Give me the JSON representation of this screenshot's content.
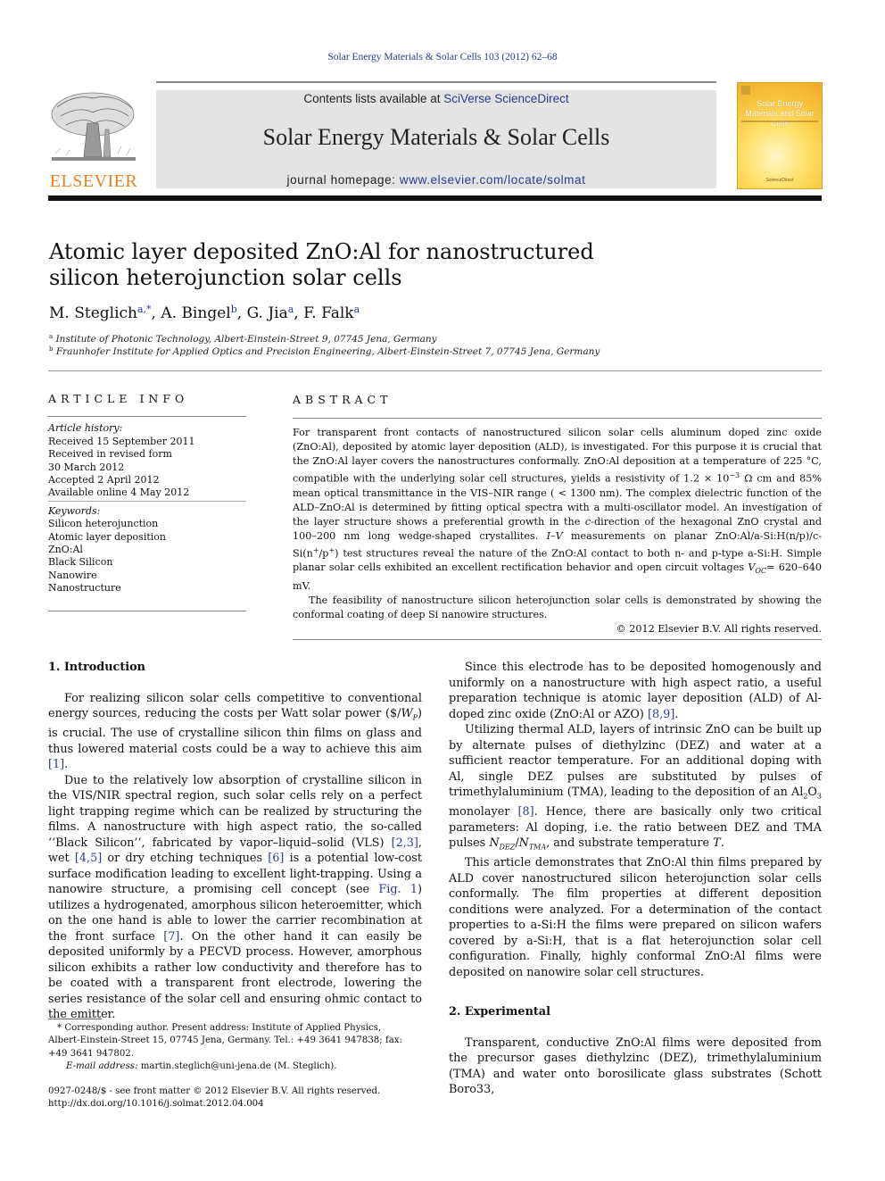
{
  "journal": {
    "running_head": "Solar Energy Materials & Solar Cells 103 (2012) 62–68",
    "contents_prefix": "Contents lists available at ",
    "contents_link": "SciVerse ScienceDirect",
    "title": "Solar Energy Materials & Solar Cells",
    "homepage_prefix": "journal homepage: ",
    "homepage_link": "www.elsevier.com/locate/solmat",
    "publisher_logo_text": "ELSEVIER",
    "cover_title": "Solar Energy Materials and Solar Cells",
    "cover_footer": "ScienceDirect",
    "colors": {
      "link": "#2a3b8f",
      "publisher_orange": "#e8801f",
      "banner_bg": "#e4e4e4"
    }
  },
  "article": {
    "title_line1": "Atomic layer deposited ZnO:Al for nanostructured",
    "title_line2": "silicon heterojunction solar cells",
    "authors": [
      {
        "name": "M. Steglich",
        "sup": "a,",
        "star": "*",
        "sep": ", "
      },
      {
        "name": "A. Bingel",
        "sup": "b",
        "sep": ", "
      },
      {
        "name": "G. Jia",
        "sup": "a",
        "sep": ", "
      },
      {
        "name": "F. Falk",
        "sup": "a",
        "sep": ""
      }
    ],
    "affiliations": [
      {
        "mark": "a",
        "text": "Institute of Photonic Technology, Albert-Einstein-Street 9, 07745 Jena, Germany"
      },
      {
        "mark": "b",
        "text": "Fraunhofer Institute for Applied Optics and Precision Engineering, Albert-Einstein-Street 7, 07745 Jena, Germany"
      }
    ]
  },
  "article_info": {
    "heading": "ARTICLE INFO",
    "history_label": "Article history:",
    "history": [
      "Received 15 September 2011",
      "Received in revised form",
      "30 March 2012",
      "Accepted 2 April 2012",
      "Available online 4 May 2012"
    ],
    "keywords_label": "Keywords:",
    "keywords": [
      "Silicon heterojunction",
      "Atomic layer deposition",
      "ZnO:Al",
      "Black Silicon",
      "Nanowire",
      "Nanostructure"
    ]
  },
  "abstract": {
    "heading": "ABSTRACT",
    "p1_a": "For transparent front contacts of nanostructured silicon solar cells aluminum doped zinc oxide (ZnO:Al), deposited by atomic layer deposition (ALD), is investigated. For this purpose it is crucial that the ZnO:Al layer covers the nanostructures conformally. ZnO:Al deposition at a temperature of 225 °C, compatible with the underlying solar cell structures, yields a resistivity of 1.2 × 10",
    "p1_exp": "−3",
    "p1_b": " Ω cm and 85% mean optical transmittance in the VIS–NIR range ( < 1300 nm). The complex dielectric function of the ALD–ZnO:Al is determined by fitting optical spectra with a multi-oscillator model. An investigation of the layer structure shows a preferential growth in the ",
    "p1_c_italic": "c",
    "p1_c": "-direction of the hexagonal ZnO crystal and 100–200 nm long wedge-shaped crystallites. ",
    "p1_iv": "I–V",
    "p1_d": " measurements on planar ZnO:Al/a-Si:H(n/p)/c-Si(n",
    "p1_sup1": "+",
    "p1_e": "/p",
    "p1_sup2": "+",
    "p1_f": ") test structures reveal the nature of the ZnO:Al contact to both n- and p-type a-Si:H. Simple planar solar cells exhibited an excellent rectification behavior and open circuit voltages ",
    "p1_voc": "V",
    "p1_voc_sub": "OC",
    "p1_g": "= 620–640 mV.",
    "p2": "The feasibility of nanostructure silicon heterojunction solar cells is demonstrated by showing the conformal coating of deep Si nanowire structures.",
    "copyright": "© 2012 Elsevier B.V. All rights reserved."
  },
  "body": {
    "intro_heading": "1.  Introduction",
    "intro_p1_a": "For realizing silicon solar cells competitive to conventional energy sources, reducing the costs per Watt solar power ($/",
    "intro_p1_wp": "W",
    "intro_p1_wp_sub": "P",
    "intro_p1_b": ") is crucial. The use of crystalline silicon thin films on glass and thus lowered material costs could be a way to achieve this aim ",
    "ref1": "[1]",
    "intro_p2_a": "Due to the relatively low absorption of crystalline silicon in the VIS/NIR spectral region, such solar cells rely on a perfect light trapping regime which can be realized by structuring the films. A nanostructure with high aspect ratio, the so-called ‘‘Black Silicon’’, fabricated by vapor–liquid–solid (VLS) ",
    "ref23": "[2,3]",
    "intro_p2_b": ", wet ",
    "ref45": "[4,5]",
    "intro_p2_c": " or dry etching techniques ",
    "ref6": "[6]",
    "intro_p2_d": " is a potential low-cost surface modification leading to excellent light-trapping. Using a nanowire structure, a promising cell concept (see ",
    "fig1": "Fig. 1",
    "intro_p2_e": ") utilizes a hydrogenated, amorphous silicon heteroemitter, which on the one hand is able to lower the carrier recombination at the front surface ",
    "ref7": "[7]",
    "intro_p2_f": ". On the other hand it can easily be deposited uniformly by a PECVD process. However, amorphous silicon exhibits a rather low conductivity and therefore has to be coated with a transparent front electrode, lowering the series resistance of the solar cell and ensuring ohmic contact to the emitter.",
    "right_p1_a": "Since this electrode has to be deposited homogenously and uniformly on a nanostructure with high aspect ratio, a useful preparation technique is atomic layer deposition (ALD) of Al-doped zinc oxide (ZnO:Al or AZO) ",
    "ref89": "[8,9]",
    "right_p2_a": "Utilizing thermal ALD, layers of intrinsic ZnO can be built up by alternate pulses of diethylzinc (DEZ) and water at a sufficient reactor temperature. For an additional doping with Al, single DEZ pulses are substituted by pulses of trimethylaluminium (TMA), leading to the deposition of an Al",
    "right_p2_sub2": "2",
    "right_p2_o": "O",
    "right_p2_sub3": "3",
    "right_p2_b": " monolayer ",
    "ref8": "[8]",
    "right_p2_c": ". Hence, there are basically only two critical parameters: Al doping, i.e. the ratio between DEZ and TMA pulses ",
    "ndez": "N",
    "ndez_sub": "DEZ",
    "ntma": "N",
    "ntma_sub": "TMA",
    "right_p2_d": ", and substrate temperature ",
    "temp_T": "T",
    "right_p3": "This article demonstrates that ZnO:Al thin films prepared by ALD cover nanostructured silicon heterojunction solar cells conformally. The film properties at different deposition conditions were analyzed. For a determination of the contact properties to a-Si:H the films were prepared on silicon wafers covered by a-Si:H, that is a flat heterojunction solar cell configuration. Finally, highly conformal ZnO:Al films were deposited on nanowire solar cell structures.",
    "exp_heading": "2.  Experimental",
    "exp_p1": "Transparent, conductive ZnO:Al films were deposited from the precursor gases diethylzinc (DEZ), trimethylaluminium (TMA) and water onto borosilicate glass substrates (Schott Boro33,"
  },
  "footnotes": {
    "corresponding": "* Corresponding author. Present address: Institute of Applied Physics, Albert-Einstein-Street 15, 07745 Jena, Germany. Tel.: +49 3641 947838; fax: +49 3641 947802.",
    "email_label": "E-mail address:",
    "email": "martin.steglich@uni-jena.de",
    "email_suffix": " (M. Steglich).",
    "issn": "0927-0248/$ - see front matter © 2012 Elsevier B.V. All rights reserved.",
    "doi": "http://dx.doi.org/10.1016/j.solmat.2012.04.004"
  }
}
